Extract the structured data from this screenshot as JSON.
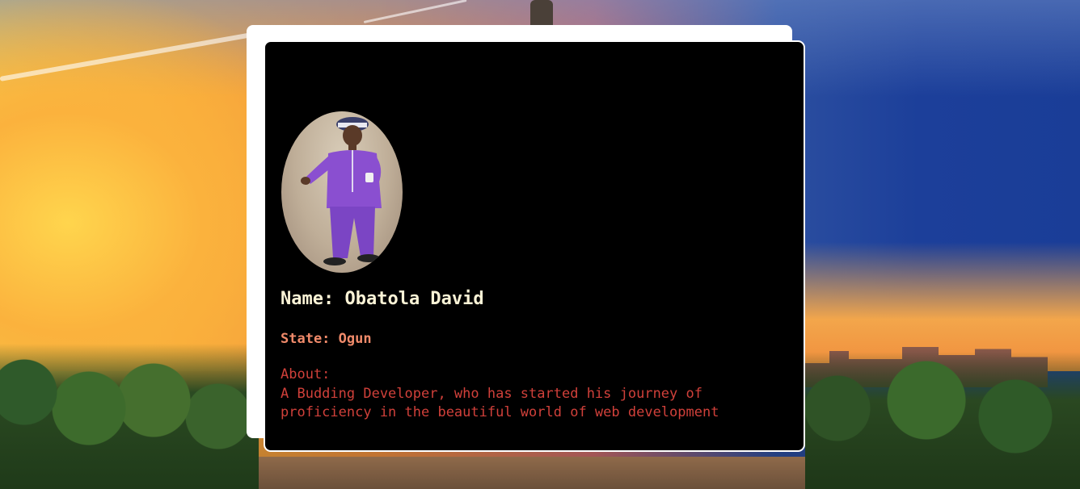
{
  "profile": {
    "name_line": "Name: Obatola David",
    "state_line": "State: Ogun",
    "about_label": "About:",
    "about_text": "A Budding Developer, who has started his journey of proficiency in the beautiful world of web development"
  },
  "colors": {
    "card_background": "#000000",
    "name_color": "#fbf3d6",
    "state_color": "#f08a6a",
    "about_color": "#d0403a",
    "panel_back": "#ffffff"
  }
}
